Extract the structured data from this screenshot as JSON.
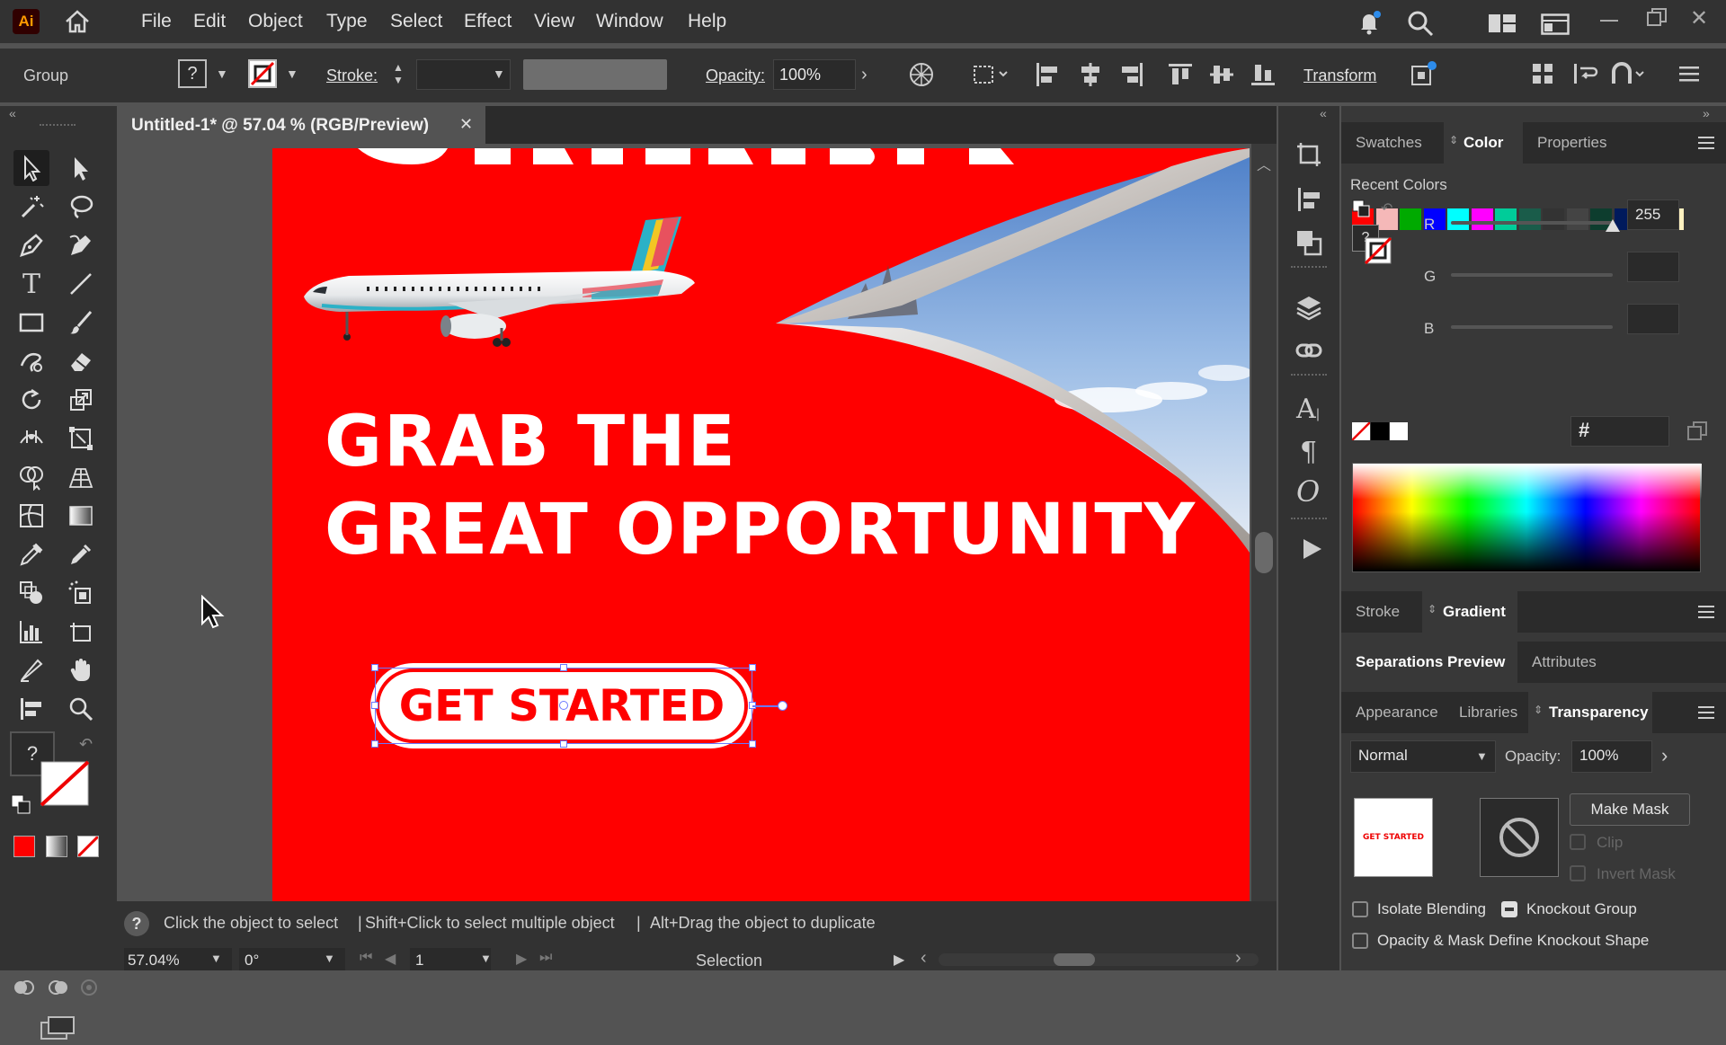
{
  "app": {
    "logo": "Ai"
  },
  "menu": [
    "File",
    "Edit",
    "Object",
    "Type",
    "Select",
    "Effect",
    "View",
    "Window",
    "Help"
  ],
  "control": {
    "selection_type": "Group",
    "stroke_label": "Stroke:",
    "opacity_label": "Opacity:",
    "opacity_value": "100%",
    "transform_label": "Transform"
  },
  "document": {
    "tab_title": "Untitled-1* @ 57.04 % (RGB/Preview)",
    "close_glyph": "✕"
  },
  "artwork": {
    "headline_line1": "GRAB THE",
    "headline_line2": "GREAT OPPORTUNITY",
    "button_label": "GET STARTED",
    "background_color": "#ff0000"
  },
  "status": {
    "help_icon": "?",
    "hint_part1": "Click the object to select",
    "hint_part2": "Shift+Click to select multiple object",
    "hint_part3": "Alt+Drag the object to duplicate",
    "zoom": "57.04%",
    "rotation": "0°",
    "artboard_number": "1",
    "tool_name": "Selection"
  },
  "right_panel": {
    "tabs_top": [
      "Swatches",
      "Color",
      "Properties"
    ],
    "recent_colors_label": "Recent Colors",
    "recent_colors": [
      "#ff0000",
      "#f5b8b8",
      "#00aa00",
      "#0000ff",
      "#00ffff",
      "#ff00ff",
      "#00cc99",
      "#1a5c4a",
      "#333333",
      "#444444",
      "#0d3d2e",
      "#001a5c",
      "#0000cc",
      "#fff2c0"
    ],
    "r_label": "R",
    "r_value": "255",
    "g_label": "G",
    "b_label": "B",
    "hex_label": "#",
    "tabs_stroke": [
      "Stroke",
      "Gradient"
    ],
    "tabs_sep": [
      "Separations Preview",
      "Attributes"
    ],
    "tabs_bottom": [
      "Appearance",
      "Libraries",
      "Transparency"
    ],
    "blend_mode": "Normal",
    "opacity_label": "Opacity:",
    "opacity_value": "100%",
    "thumb_text": "GET STARTED",
    "make_mask": "Make Mask",
    "clip": "Clip",
    "invert_mask": "Invert Mask",
    "isolate_blending": "Isolate Blending",
    "knockout_group": "Knockout Group",
    "opacity_mask_knockout": "Opacity & Mask Define Knockout Shape"
  }
}
